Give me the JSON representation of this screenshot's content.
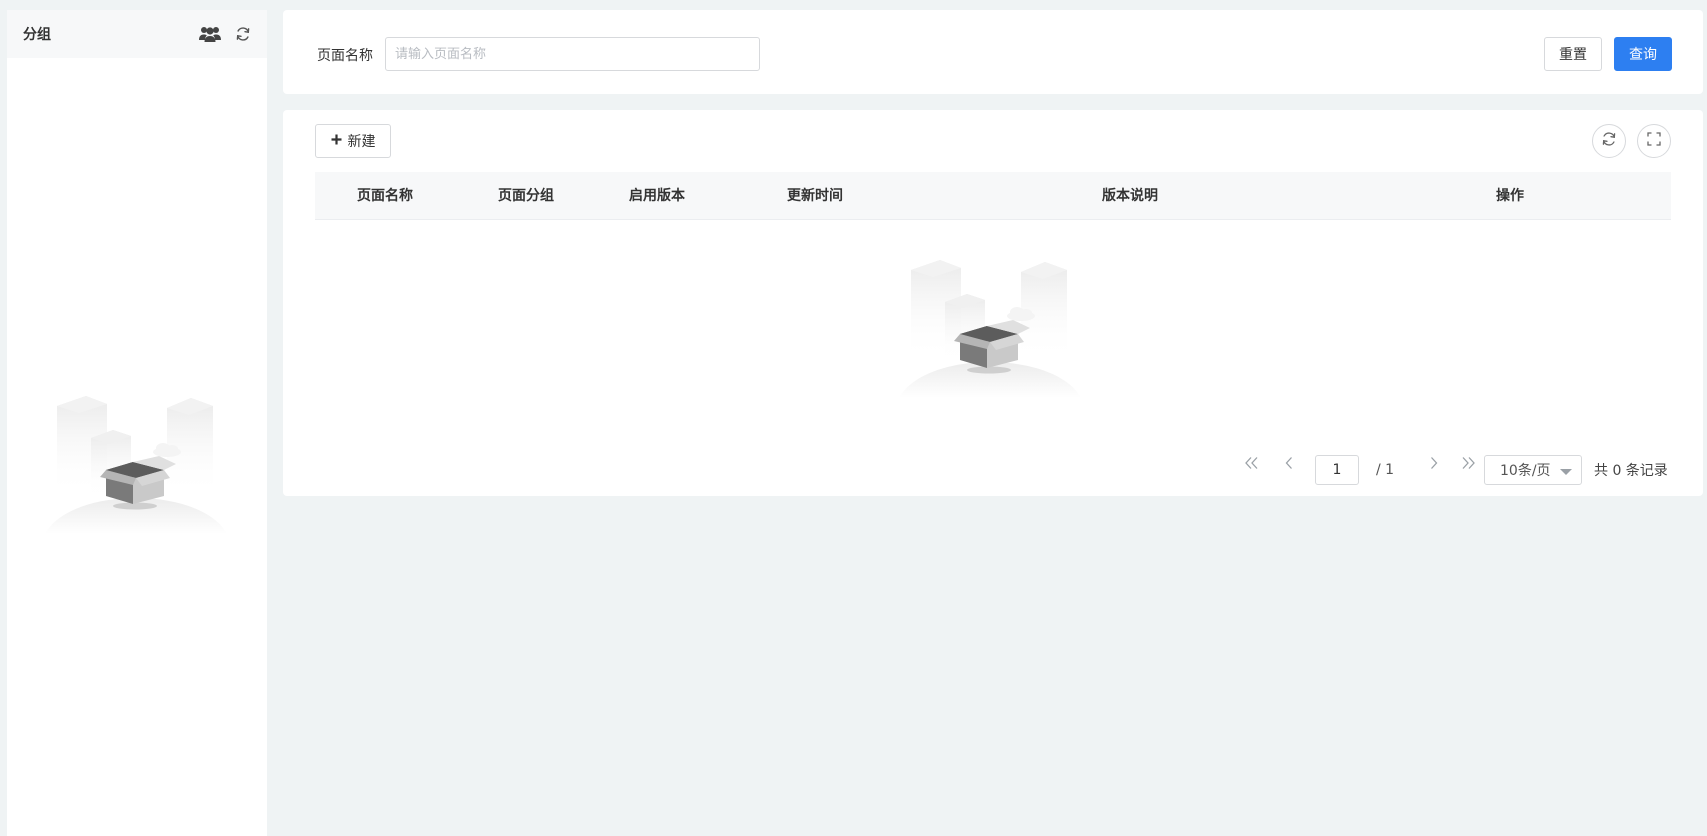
{
  "sidebar": {
    "title": "分组",
    "group_icon": "users-group-icon",
    "refresh_icon": "refresh-icon"
  },
  "search": {
    "label": "页面名称",
    "placeholder": "请输入页面名称",
    "value": "",
    "reset_label": "重置",
    "query_label": "查询"
  },
  "toolbar": {
    "new_label": "新建",
    "new_icon": "plus-icon",
    "refresh_icon": "refresh-icon",
    "fullscreen_icon": "fullscreen-icon"
  },
  "table": {
    "columns": [
      "页面名称",
      "页面分组",
      "启用版本",
      "更新时间",
      "版本说明",
      "操作"
    ],
    "rows": []
  },
  "pagination": {
    "current_page": "1",
    "total_pages": "/ 1",
    "page_size": "10条/页",
    "record_count": "共 0 条记录"
  },
  "colors": {
    "primary": "#2d7ff1",
    "page_background": "#eff3f4",
    "header_background": "#f7f8f9"
  }
}
